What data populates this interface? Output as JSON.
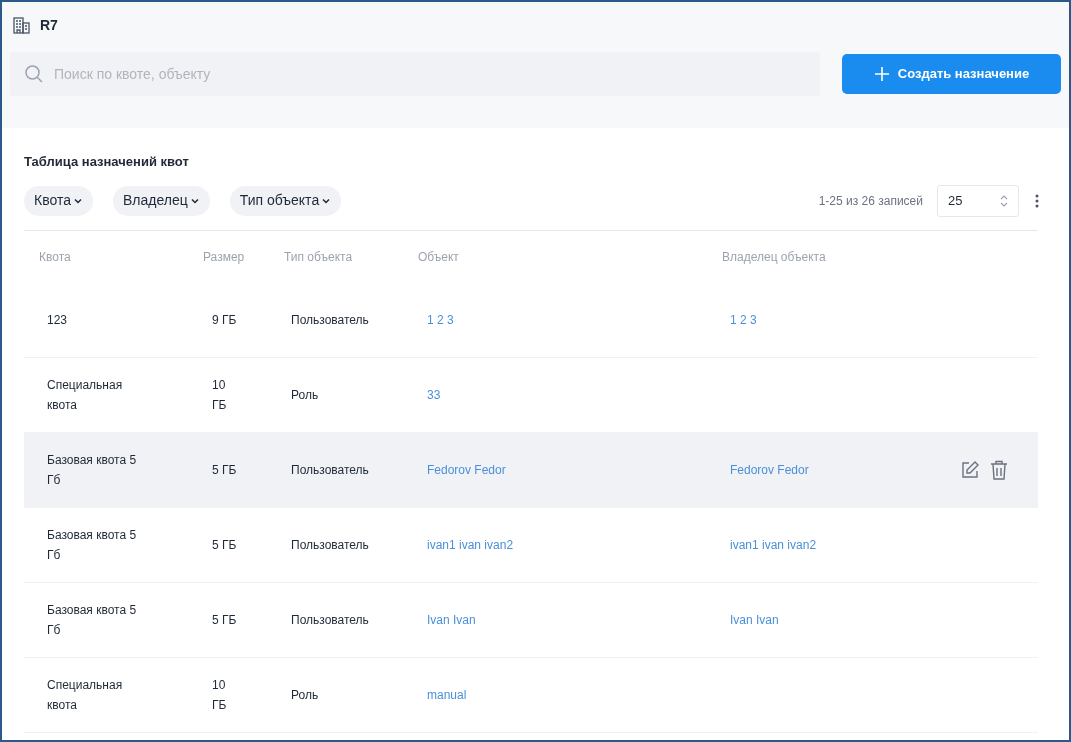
{
  "header": {
    "title": "R7"
  },
  "search": {
    "placeholder": "Поиск по квоте, объекту"
  },
  "create_button": {
    "label": "Создать назначение"
  },
  "table_title": "Таблица назначений квот",
  "filters": [
    {
      "label": "Квота"
    },
    {
      "label": "Владелец"
    },
    {
      "label": "Тип объекта"
    }
  ],
  "pagination": {
    "summary": "1-25 из 26 записей",
    "page_size": "25"
  },
  "table": {
    "columns": [
      "Квота",
      "Размер",
      "Тип объекта",
      "Объект",
      "Владелец объекта"
    ],
    "rows": [
      {
        "quota": "123",
        "size": "9 ГБ",
        "object_type": "Пользователь",
        "object": "1 2 3",
        "owner": "1 2 3",
        "hovered": false
      },
      {
        "quota": "Специальная квота",
        "size": "10 ГБ",
        "object_type": "Роль",
        "object": "33",
        "hovered": false
      },
      {
        "quota": "Базовая квота 5 Гб",
        "size": "5 ГБ",
        "object_type": "Пользователь",
        "object": "Fedorov Fedor",
        "owner": "Fedorov Fedor",
        "hovered": true
      },
      {
        "quota": "Базовая квота 5 Гб",
        "size": "5 ГБ",
        "object_type": "Пользователь",
        "object": "ivan1 ivan ivan2",
        "owner": "ivan1 ivan ivan2",
        "hovered": false
      },
      {
        "quota": "Базовая квота 5 Гб",
        "size": "5 ГБ",
        "object_type": "Пользователь",
        "object": "Ivan Ivan",
        "owner": "Ivan Ivan",
        "hovered": false
      },
      {
        "quota": "Специальная квота",
        "size": "10 ГБ",
        "object_type": "Роль",
        "object": "manual",
        "hovered": false
      }
    ]
  }
}
